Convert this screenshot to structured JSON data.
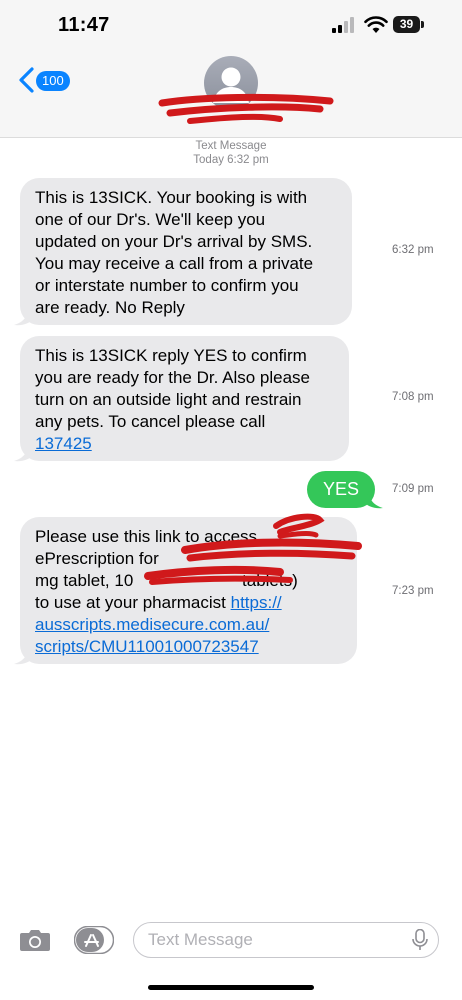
{
  "status_bar": {
    "time": "11:47",
    "battery": "39"
  },
  "header": {
    "unread_count": "100"
  },
  "thread": {
    "service_label": "Text Message",
    "date_label": "Today 6:32 pm",
    "messages": [
      {
        "direction": "incoming",
        "time": "6:32 pm",
        "lines": [
          "This is 13SICK. Your booking is with",
          "one of our Dr's. We'll keep you",
          "updated on your Dr's arrival by SMS.",
          "You may receive a call from a private",
          "or interstate number to confirm you",
          "are ready. No Reply"
        ]
      },
      {
        "direction": "incoming",
        "time": "7:08 pm",
        "lines": [
          "This is 13SICK reply YES to confirm",
          "you are ready for the Dr. Also please",
          "turn on an outside light and restrain",
          "any pets. To cancel please call"
        ],
        "link": "137425"
      },
      {
        "direction": "outgoing",
        "time": "7:09 pm",
        "text": "YES"
      },
      {
        "direction": "incoming",
        "time": "7:23 pm",
        "lines": [
          "Please use this link to access",
          "ePrescription for",
          "mg tablet, 10",
          "tablets)"
        ],
        "suffix": "to use at your pharmacist",
        "link_parts": [
          "https://",
          "ausscripts.medisecure.com.au/",
          "scripts/CMU11001000723547"
        ]
      }
    ]
  },
  "composer": {
    "placeholder": "Text Message"
  },
  "colors": {
    "incoming_bubble": "#e9e9eb",
    "outgoing_bubble": "#34c759",
    "accent": "#0a84ff",
    "redaction": "#d0191b"
  },
  "icons": [
    "signal-icon",
    "wifi-icon",
    "battery-icon",
    "back-chevron-icon",
    "contact-avatar-icon",
    "camera-icon",
    "app-store-icon",
    "microphone-icon"
  ]
}
